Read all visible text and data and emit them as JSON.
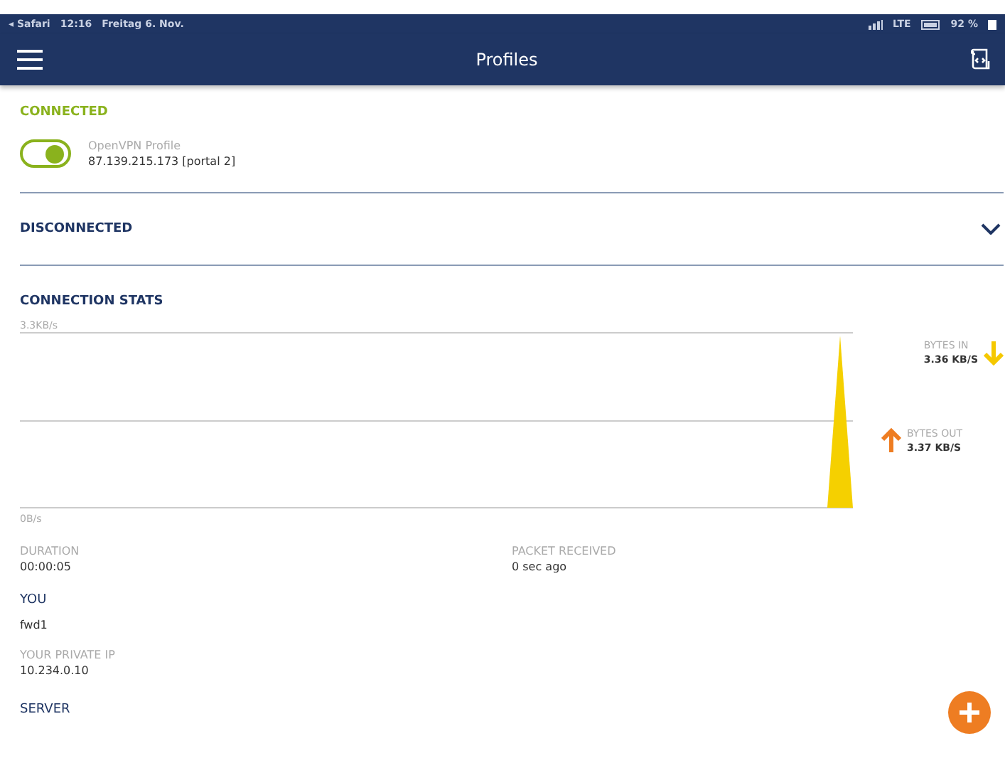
{
  "status_bar": {
    "left": [
      "◂ Safari",
      "12:16",
      "Freitag 6. Nov."
    ],
    "network": "LTE",
    "battery": "92 %"
  },
  "app_bar": {
    "title": "Profiles"
  },
  "connected": {
    "heading": "CONNECTED",
    "profile": {
      "name": "OpenVPN Profile",
      "address": "87.139.215.173 [portal 2]",
      "on": true
    }
  },
  "disconnected": {
    "heading": "DISCONNECTED",
    "expanded": false
  },
  "stats": {
    "heading": "CONNECTION STATS",
    "top_label": "3.3KB/s",
    "bottom_label": "0B/s",
    "legend": [
      {
        "kind": "in",
        "label": "BYTES IN",
        "value": "3.36 KB/S",
        "color": "#f5c800"
      },
      {
        "kind": "out",
        "label": "BYTES OUT",
        "value": "3.37 KB/S",
        "color": "#ee7d22"
      }
    ],
    "details": [
      {
        "label": "DURATION",
        "value": "00:00:05"
      },
      {
        "label": "PACKET RECEIVED",
        "value": "0 sec ago"
      }
    ]
  },
  "you": {
    "heading": "YOU",
    "name": "fwd1",
    "fields": [
      {
        "label": "YOUR PRIVATE IP",
        "value": "10.234.0.10"
      }
    ]
  },
  "server": {
    "heading": "SERVER"
  }
}
